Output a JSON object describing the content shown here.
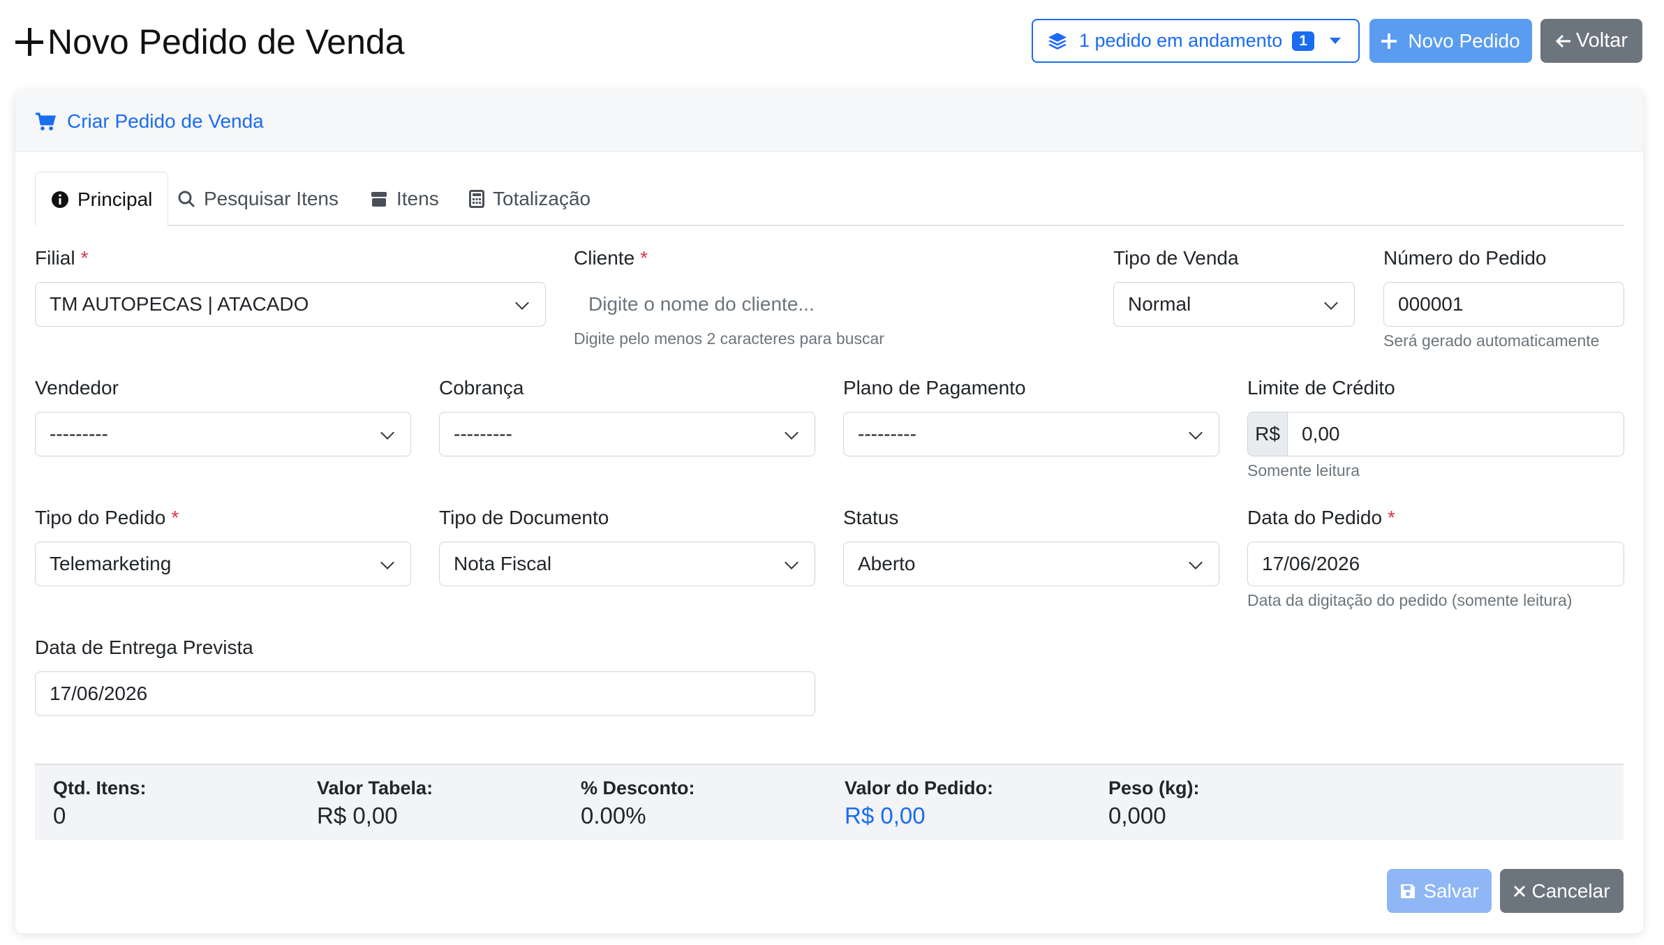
{
  "header": {
    "title": "Novo Pedido de Venda",
    "progress_label": "1 pedido em andamento",
    "progress_count": "1",
    "new_order_label": "Novo Pedido",
    "back_label": "Voltar"
  },
  "card": {
    "title": "Criar Pedido de Venda"
  },
  "tabs": [
    {
      "label": "Principal",
      "icon": "info-circle-icon",
      "active": true
    },
    {
      "label": "Pesquisar Itens",
      "icon": "search-icon"
    },
    {
      "label": "Itens",
      "icon": "box-icon"
    },
    {
      "label": "Totalização",
      "icon": "calculator-icon"
    }
  ],
  "form": {
    "filial": {
      "label": "Filial",
      "value": "TM AUTOPECAS | ATACADO"
    },
    "cliente": {
      "label": "Cliente",
      "placeholder": "Digite o nome do cliente...",
      "hint": "Digite pelo menos 2 caracteres para buscar"
    },
    "tipo_venda": {
      "label": "Tipo de Venda",
      "value": "Normal"
    },
    "numero_pedido": {
      "label": "Número do Pedido",
      "value": "000001",
      "hint": "Será gerado automaticamente"
    },
    "vendedor": {
      "label": "Vendedor",
      "value": "---------"
    },
    "cobranca": {
      "label": "Cobrança",
      "value": "---------"
    },
    "plano_pagamento": {
      "label": "Plano de Pagamento",
      "value": "---------"
    },
    "limite_credito": {
      "label": "Limite de Crédito",
      "prefix": "R$",
      "value": "0,00",
      "hint": "Somente leitura"
    },
    "tipo_pedido": {
      "label": "Tipo do Pedido",
      "value": "Telemarketing"
    },
    "tipo_documento": {
      "label": "Tipo de Documento",
      "value": "Nota Fiscal"
    },
    "status": {
      "label": "Status",
      "value": "Aberto"
    },
    "data_pedido": {
      "label": "Data do Pedido",
      "value": "17/06/2026",
      "hint": "Data da digitação do pedido (somente leitura)"
    },
    "data_entrega": {
      "label": "Data de Entrega Prevista",
      "value": "17/06/2026"
    },
    "required_mark": "*"
  },
  "totals": {
    "qtd_itens": {
      "label": "Qtd. Itens:",
      "value": "0"
    },
    "valor_tabela": {
      "label": "Valor Tabela:",
      "value": "R$ 0,00"
    },
    "desconto": {
      "label": "% Desconto:",
      "value": "0.00%"
    },
    "valor_pedido": {
      "label": "Valor do Pedido:",
      "value": "R$ 0,00"
    },
    "peso": {
      "label": "Peso (kg):",
      "value": "0,000"
    }
  },
  "actions": {
    "save_label": "Salvar",
    "cancel_label": "Cancelar"
  },
  "colors": {
    "primary": "#1a6cf0",
    "primary_light": "#5a9cf0",
    "secondary": "#6c757d",
    "danger": "#dc3545"
  }
}
